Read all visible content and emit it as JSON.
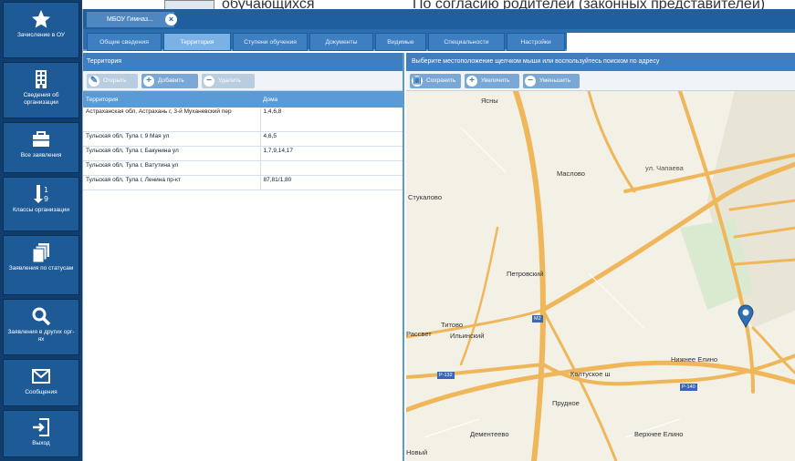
{
  "background": {
    "text_left": "обучающихся",
    "text_right": "По согласию родителей (законных представителей)"
  },
  "sidebar": {
    "items": [
      {
        "label": "Зачисление в ОУ",
        "icon": "star-icon"
      },
      {
        "label": "Сведения об организации",
        "icon": "building-icon"
      },
      {
        "label": "Все заявления",
        "icon": "briefcase-icon"
      },
      {
        "label": "Классы организации",
        "icon": "sort-icon"
      },
      {
        "label": "Заявления по статусам",
        "icon": "copy-icon"
      },
      {
        "label": "Заявления в других орг-ях",
        "icon": "search-icon"
      },
      {
        "label": "Сообщения",
        "icon": "envelope-icon"
      },
      {
        "label": "Выход",
        "icon": "exit-icon"
      }
    ]
  },
  "window": {
    "tab_title": "МБОУ Гимназ...",
    "tabs": [
      "Общие сведения",
      "Территория",
      "Ступени обучения",
      "Документы",
      "Видимые",
      "Специальности",
      "Настройки"
    ],
    "active_tab": "Территория"
  },
  "left_panel": {
    "title": "Территория",
    "buttons": {
      "open": "Открыть",
      "add": "Добавить",
      "delete": "Удалить"
    },
    "columns": [
      "Территория",
      "Дома"
    ],
    "rows": [
      {
        "territory": "Астраханская обл, Астрахань г, 3-й Муханевский пер",
        "houses": "1,4,6,8"
      },
      {
        "territory": "Тульская обл, Тула г, 9 Мая ул",
        "houses": "4,6,5"
      },
      {
        "territory": "Тульская обл, Тула г, Бакунина ул",
        "houses": "1,7,9,14,17"
      },
      {
        "territory": "Тульская обл, Тула г, Ватутина ул",
        "houses": ""
      },
      {
        "territory": "Тульская обл, Тула г, Ленина пр-кт",
        "houses": "87,81/1,80"
      }
    ]
  },
  "right_panel": {
    "title": "Выберите местоположение щелчком мыши или воспользуйтесь поиском по адресу",
    "buttons": {
      "save": "Сохранить",
      "zoom_in": "Увеличить",
      "zoom_out": "Уменьшить"
    }
  },
  "map": {
    "labels": {
      "yasny": "Ясны",
      "maslovo": "Маслово",
      "chapaeva": "ул. Чапаева",
      "stukalovo": "Стукалово",
      "petrovsky": "Петровский",
      "rassvet": "Рассвет",
      "titovo": "Титово",
      "ilinsky": "Ильинский",
      "kolyuskoe": "Колтуское ш",
      "prudnoe": "Прудное",
      "dementeevo": "Дементеево",
      "nizhnee": "Нижнее Елино",
      "verkhnee": "Верхнее Елино",
      "novy": "Новый",
      "rd_m2": "М2",
      "rd_p132": "Р-132",
      "rd_p140": "Р-140"
    },
    "marker_color": "#2f6db5",
    "road_color": "#f0b65a"
  }
}
